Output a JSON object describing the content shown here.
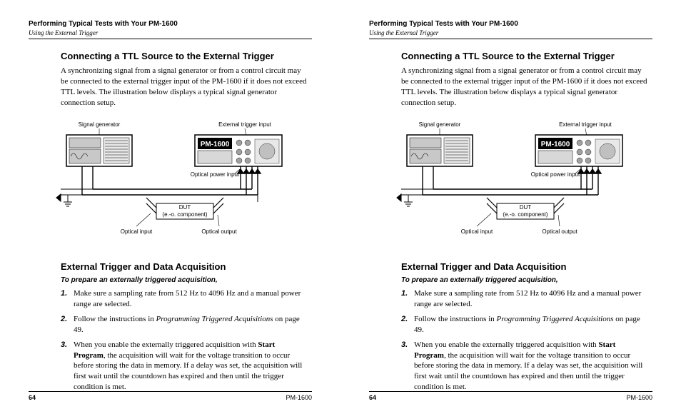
{
  "header": {
    "title": "Performing Typical Tests with Your PM-1600",
    "subtitle": "Using the External Trigger"
  },
  "section1": {
    "heading": "Connecting a TTL Source to the External Trigger",
    "body": "A synchronizing signal from a signal generator or from a control circuit may be connected to the external trigger input of the PM-1600 if it does not exceed TTL levels. The illustration below displays a typical signal generator connection setup."
  },
  "diagram": {
    "sig_gen": "Signal generator",
    "ext_trig": "External trigger input",
    "pm1600": "PM-1600",
    "opt_power": "Optical power input",
    "dut_top": "DUT",
    "dut_bottom": "(e.-o. component)",
    "opt_in": "Optical input",
    "opt_out": "Optical output"
  },
  "section2": {
    "heading": "External Trigger and Data Acquisition",
    "subhead": "To prepare an externally triggered acquisition,",
    "steps": {
      "s1": "Make sure a sampling rate from 512 Hz to 4096 Hz and a manual power range are selected.",
      "s2a": "Follow the instructions in ",
      "s2b": "Programming Triggered Acquisitions",
      "s2c": " on page 49.",
      "s3a": "When you enable the externally triggered acquisition with ",
      "s3b": "Start Program",
      "s3c": ", the acquisition will wait for the voltage transition to occur before storing the data in memory. If a delay was set, the acquisition will first wait until the countdown has expired and then until the trigger condition is met."
    }
  },
  "footer": {
    "page": "64",
    "doc": "PM-1600"
  }
}
